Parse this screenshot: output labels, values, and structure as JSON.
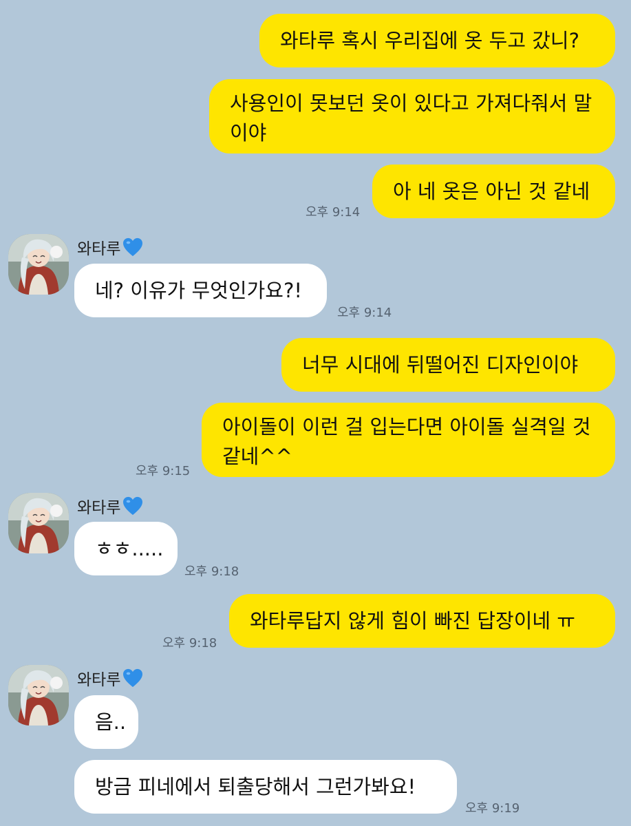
{
  "colors": {
    "background": "#b2c7d9",
    "my_bubble": "#fee500",
    "their_bubble": "#ffffff",
    "time_text": "#556270",
    "heart": "#2f8fe8"
  },
  "sender_name": "와타루",
  "sender_icon": "blue-heart-icon",
  "messages": [
    {
      "from": "me",
      "text": "와타루 혹시 우리집에 옷 두고 갔니?"
    },
    {
      "from": "me",
      "text": "사용인이 못보던 옷이 있다고 가져다줘서 말이야"
    },
    {
      "from": "me",
      "text": "아 네 옷은 아닌 것 같네",
      "time": "오후 9:14"
    },
    {
      "from": "them",
      "text": "네? 이유가 무엇인가요?!",
      "time": "오후 9:14"
    },
    {
      "from": "me",
      "text": "너무 시대에 뒤떨어진 디자인이야"
    },
    {
      "from": "me",
      "text": "아이돌이 이런 걸 입는다면 아이돌 실격일 것 같네^^",
      "time": "오후 9:15"
    },
    {
      "from": "them",
      "text": "ㅎㅎ.....",
      "time": "오후 9:18"
    },
    {
      "from": "me",
      "text": "와타루답지 않게 힘이 빠진 답장이네 ㅠ",
      "time": "오후 9:18"
    },
    {
      "from": "them",
      "text": "음.."
    },
    {
      "from": "them",
      "text": "방금 피네에서 퇴출당해서 그런가봐요!",
      "time": "오후 9:19"
    }
  ]
}
